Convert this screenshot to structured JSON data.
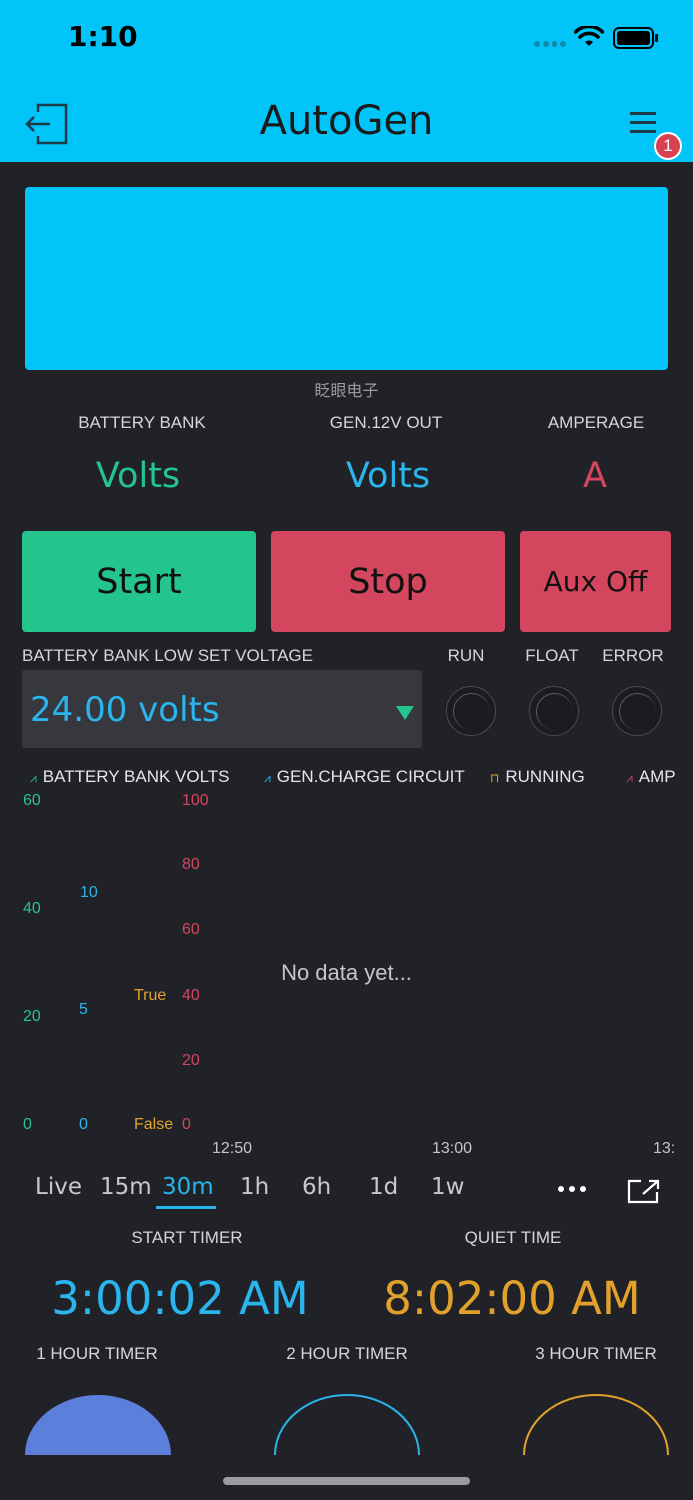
{
  "status_bar": {
    "time": "1:10"
  },
  "header": {
    "title": "AutoGen",
    "notification_count": "1"
  },
  "lcd": {
    "caption": "眨眼电子",
    "color": "#01c4f9"
  },
  "readings": [
    {
      "label": "BATTERY BANK",
      "value": "Volts",
      "color": "#24c48d"
    },
    {
      "label": "GEN.12V OUT",
      "value": "Volts",
      "color": "#2ab5ec"
    },
    {
      "label": "AMPERAGE",
      "value": "A",
      "color": "#d4465e"
    }
  ],
  "buttons": {
    "start": {
      "label": "Start",
      "color": "#24c48d"
    },
    "stop": {
      "label": "Stop",
      "color": "#d4465e"
    },
    "aux": {
      "label": "Aux Off",
      "color": "#d4465e"
    }
  },
  "low_voltage": {
    "label": "BATTERY BANK LOW SET VOLTAGE",
    "value": "24.00 volts"
  },
  "leds": {
    "run": "RUN",
    "float": "FLOAT",
    "error": "ERROR"
  },
  "chart": {
    "legend": [
      {
        "label": "BATTERY BANK VOLTS",
        "color": "#24c48d"
      },
      {
        "label": "GEN.CHARGE CIRCUIT",
        "color": "#2ab5ec"
      },
      {
        "label": "RUNNING",
        "color": "#e2a12b"
      },
      {
        "label": "AMP",
        "color": "#d4465e"
      }
    ],
    "empty_message": "No data yet...",
    "ticks_battery": [
      "60",
      "40",
      "20",
      "0"
    ],
    "ticks_gen": [
      "10",
      "5",
      "0"
    ],
    "ticks_running": [
      "True",
      "False"
    ],
    "ticks_amp": [
      "100",
      "80",
      "60",
      "40",
      "20",
      "0"
    ],
    "x_ticks": [
      "12:50",
      "13:00",
      "13:"
    ]
  },
  "time_ranges": [
    "Live",
    "15m",
    "30m",
    "1h",
    "6h",
    "1d",
    "1w"
  ],
  "active_range": "30m",
  "timers": {
    "start": {
      "label": "START TIMER",
      "value": "3:00:02 AM",
      "color": "#2ab5ec"
    },
    "quiet": {
      "label": "QUIET TIME",
      "value": "8:02:00 AM",
      "color": "#e2a12b"
    }
  },
  "gauges": [
    {
      "label": "1 HOUR TIMER",
      "color": "#5b7fdb",
      "filled": true
    },
    {
      "label": "2 HOUR TIMER",
      "color": "#2ab5ec",
      "filled": false
    },
    {
      "label": "3 HOUR TIMER",
      "color": "#e2a12b",
      "filled": false
    }
  ]
}
